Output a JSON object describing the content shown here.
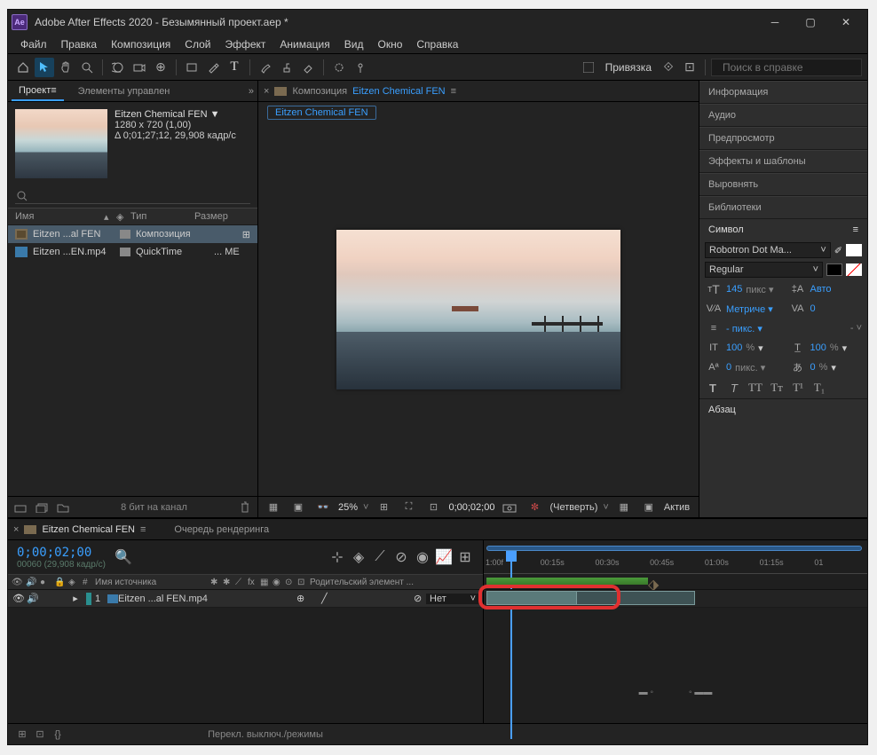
{
  "titlebar": {
    "appname": "Adobe After Effects 2020 - Безымянный проект.aep *"
  },
  "menu": [
    "Файл",
    "Правка",
    "Композиция",
    "Слой",
    "Эффект",
    "Анимация",
    "Вид",
    "Окно",
    "Справка"
  ],
  "toolbar": {
    "snap_label": "Привязка",
    "search_placeholder": "Поиск в справке"
  },
  "leftpanel": {
    "tabs": {
      "project": "Проект",
      "controls": "Элементы управлен"
    },
    "asset": {
      "name": "Eitzen Chemical FEN ▼",
      "res": "1280 x 720 (1,00)",
      "dur": "Δ 0;01;27;12, 29,908 кадр/с"
    },
    "columns": {
      "name": "Имя",
      "type": "Тип",
      "size": "Размер"
    },
    "rows": [
      {
        "name": "Eitzen ...al FEN",
        "type": "Композиция",
        "sel": true
      },
      {
        "name": "Eitzen ...EN.mp4",
        "type": "QuickTime",
        "size": "... ME",
        "sel": false
      }
    ],
    "bpc": "8 бит на канал"
  },
  "center": {
    "crumb_pre": "Композиция",
    "crumb": "Eitzen Chemical FEN",
    "sub": "Eitzen Chemical FEN",
    "zoom": "25%",
    "time": "0;00;02;00",
    "res": "(Четверть)",
    "activ": "Актив"
  },
  "right": {
    "panels": [
      "Информация",
      "Аудио",
      "Предпросмотр",
      "Эффекты и шаблоны",
      "Выровнять",
      "Библиотеки"
    ],
    "symbol_title": "Символ",
    "font": "Robotron Dot Ma...",
    "style": "Regular",
    "size": "145",
    "sizeunit": "пикс ▾",
    "leading": "Авто",
    "kerning": "Метриче ▾",
    "tracking": "0",
    "strokewidth": "- пикс. ▾",
    "vscale": "100",
    "hscale": "100",
    "baseline": "0",
    "tsume": "0",
    "pct": "%",
    "px": "пикс. ▾",
    "para_title": "Абзац"
  },
  "timeline": {
    "tab_comp": "Eitzen Chemical FEN",
    "tab_rq": "Очередь рендеринга",
    "time": "0;00;02;00",
    "timesub": "00060 (29,908 кадр/с)",
    "col_src": "Имя источника",
    "col_parent": "Родительский элемент ...",
    "layer": {
      "num": "1",
      "name": "Eitzen ...al FEN.mp4",
      "parent": "Нет"
    },
    "ticks": [
      "1:00f",
      "00:15s",
      "00:30s",
      "00:45s",
      "01:00s",
      "01:15s",
      "01"
    ],
    "footer_mode": "Перекл. выключ./режимы"
  }
}
